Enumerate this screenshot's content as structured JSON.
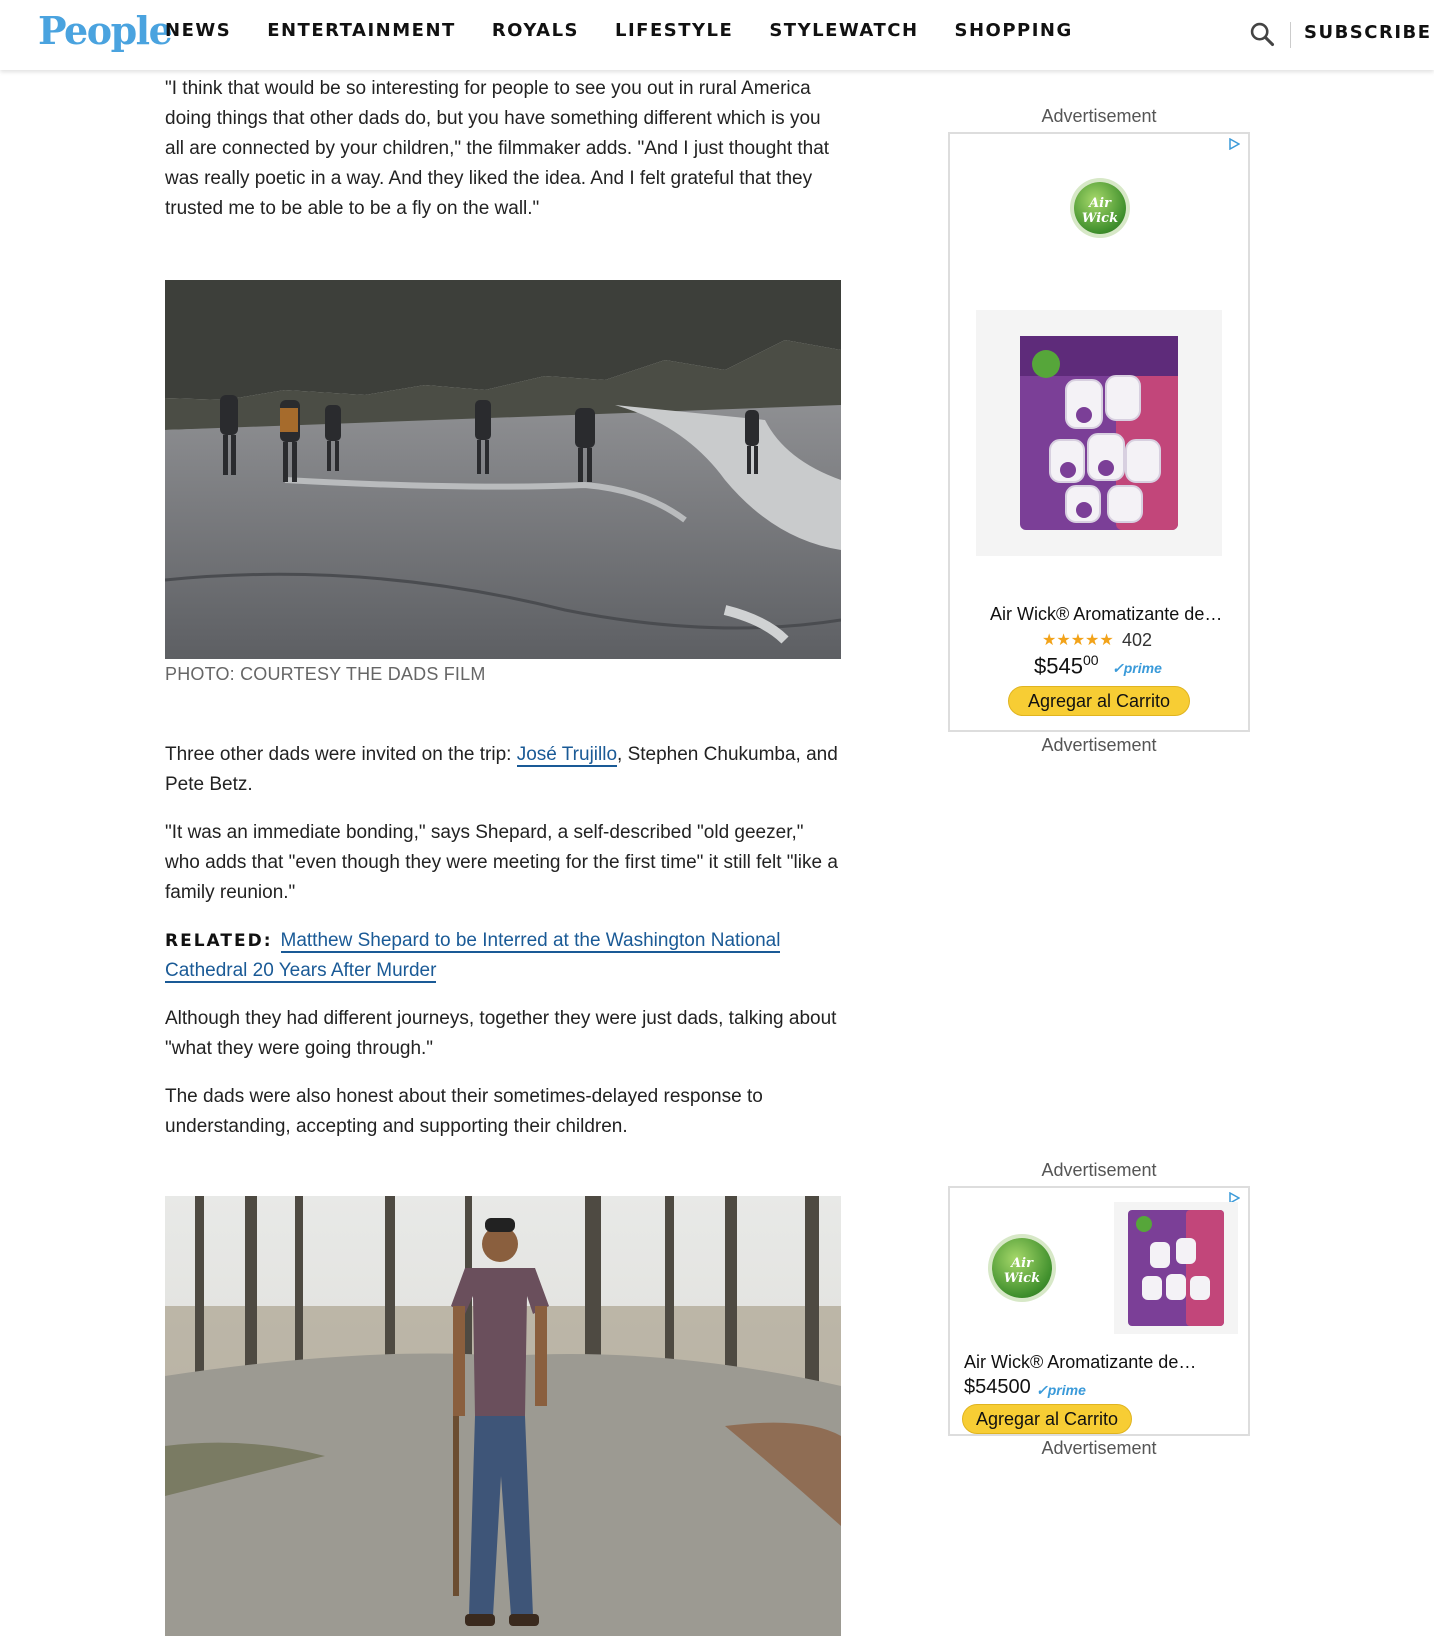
{
  "header": {
    "logo": "People",
    "nav": [
      "NEWS",
      "ENTERTAINMENT",
      "ROYALS",
      "LIFESTYLE",
      "STYLEWATCH",
      "SHOPPING"
    ],
    "subscribe": "SUBSCRIBE"
  },
  "article": {
    "p1": "\"I think that would be so interesting for people to see you out in rural America doing things that other dads do, but you have something different which is you all are connected by your children,\" the filmmaker adds. \"And I just thought that was really poetic in a way. And they liked the idea. And I felt grateful that they trusted me to be able to be a fly on the wall.\"",
    "caption": "PHOTO: COURTESY THE DADS FILM",
    "p2_before": "Three other dads were invited on the trip: ",
    "p2_link": "José Trujillo",
    "p2_after": ", Stephen Chukumba, and Pete Betz.",
    "p3": "\"It was an immediate bonding,\" says Shepard, a self-described \"old geezer,\" who adds that \"even though they were meeting for the first time\" it still felt \"like a family reunion.\"",
    "related_label": "RELATED:",
    "related_link": "Matthew Shepard to be Interred at the Washington National Cathedral 20 Years After Murder",
    "p4": "Although they had different journeys, together they were just dads, talking about \"what they were going through.\"",
    "p5": "The dads were also honest about their sometimes-delayed response to understanding, accepting and supporting their children."
  },
  "sidebar": {
    "ad_label": "Advertisement",
    "ad1": {
      "title": "Air Wick® Aromatizante de…",
      "stars": "★★★★★",
      "rating_count": "402",
      "price_currency": "$",
      "price_main": "545",
      "price_cents": "00",
      "prime": "✓prime",
      "cart": "Agregar al Carrito",
      "brand": "Air Wick"
    },
    "ad2": {
      "title": "Air Wick® Aromatizante de…",
      "price": "$54500",
      "prime": "✓prime",
      "cart": "Agregar al Carrito",
      "brand": "Air Wick"
    }
  }
}
